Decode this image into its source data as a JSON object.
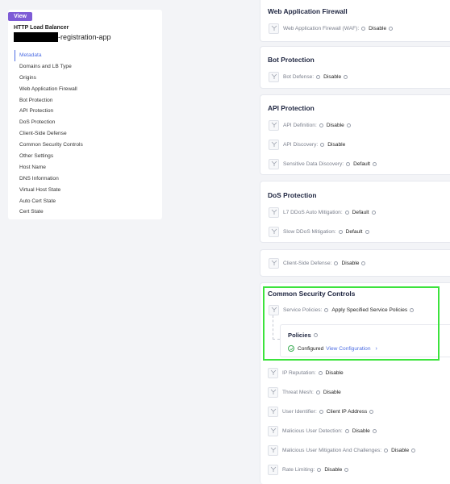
{
  "left": {
    "badge": "View",
    "lb_type": "HTTP Load Balancer",
    "lb_name_suffix": "-registration-app",
    "nav": [
      "Metadata",
      "Domains and LB Type",
      "Origins",
      "Web Application Firewall",
      "Bot Protection",
      "API Protection",
      "DoS Protection",
      "Client-Side Defense",
      "Common Security Controls",
      "Other Settings",
      "Host Name",
      "DNS Information",
      "Virtual Host State",
      "Auto Cert State",
      "Cert State"
    ]
  },
  "waf": {
    "title": "Web Application Firewall",
    "row": {
      "label": "Web Application Firewall (WAF):",
      "value": "Disable"
    }
  },
  "bot": {
    "title": "Bot Protection",
    "row": {
      "label": "Bot Defense:",
      "value": "Disable"
    }
  },
  "api": {
    "title": "API Protection",
    "rows": [
      {
        "label": "API Definition:",
        "value": "Disable"
      },
      {
        "label": "API Discovery:",
        "value": "Disable"
      },
      {
        "label": "Sensitive Data Discovery:",
        "value": "Default"
      }
    ]
  },
  "dos": {
    "title": "DoS Protection",
    "rows": [
      {
        "label": "L7 DDoS Auto Mitigation:",
        "value": "Default"
      },
      {
        "label": "Slow DDoS Mitigation:",
        "value": "Default"
      }
    ]
  },
  "csd": {
    "row": {
      "label": "Client-Side Defense:",
      "value": "Disable"
    }
  },
  "csc": {
    "title": "Common Security Controls",
    "service_policies": {
      "label": "Service Policies:",
      "value": "Apply Specified Service Policies"
    },
    "policies": {
      "title": "Policies",
      "status": "Configured",
      "link": "View Configuration"
    },
    "rows": [
      {
        "label": "IP Reputation:",
        "value": "Disable"
      },
      {
        "label": "Threat Mesh:",
        "value": "Disable"
      },
      {
        "label": "User Identifier:",
        "value": "Client IP Address"
      },
      {
        "label": "Malicious User Detection:",
        "value": "Disable"
      },
      {
        "label": "Malicious User Mitigation And Challenges:",
        "value": "Disable"
      },
      {
        "label": "Rate Limiting:",
        "value": "Disable"
      }
    ]
  },
  "colors": {
    "accent": "#4d6de3",
    "badge": "#7e5cd6",
    "highlight": "#3ce33c",
    "success": "#3cae55"
  }
}
